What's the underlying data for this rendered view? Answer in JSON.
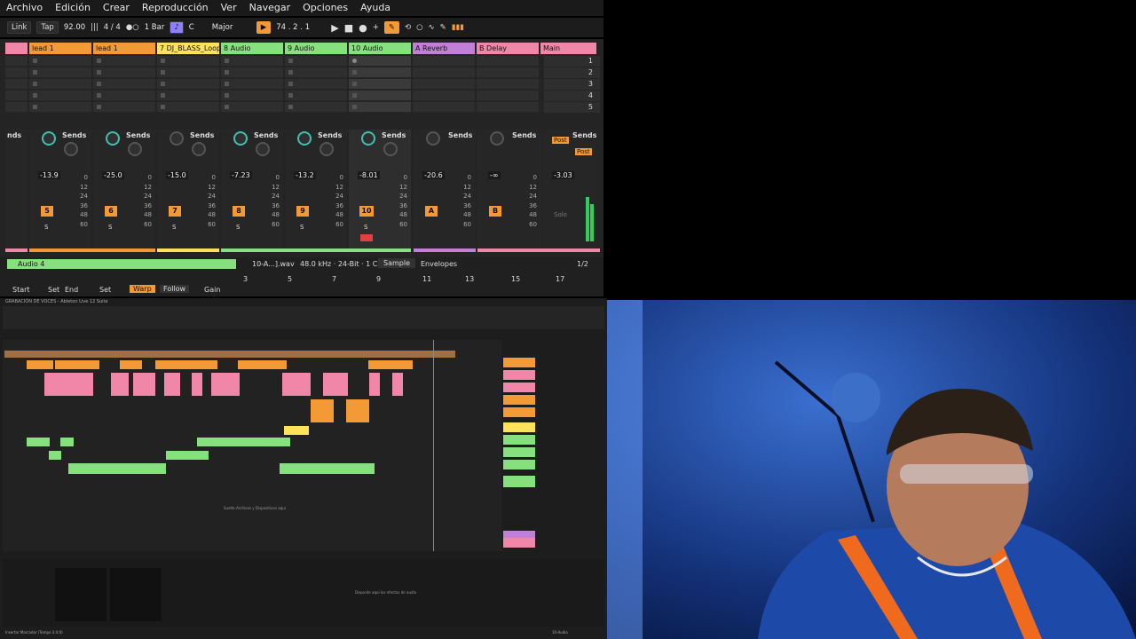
{
  "menu": [
    "Archivo",
    "Edición",
    "Crear",
    "Reproducción",
    "Ver",
    "Navegar",
    "Opciones",
    "Ayuda"
  ],
  "transport": {
    "link": "Link",
    "tap": "Tap",
    "tempo": "92.00",
    "signature": "4 / 4",
    "quantize": "1 Bar",
    "key": "C",
    "scale": "Major",
    "position": "74 .  2 .  1"
  },
  "tracks": [
    {
      "name": "",
      "color": "#f087a8"
    },
    {
      "name": "lead 1",
      "color": "#f39a36"
    },
    {
      "name": "lead 1",
      "color": "#f39a36"
    },
    {
      "name": "7 DJ_BLASS_Loop",
      "color": "#ffe15a"
    },
    {
      "name": "8 Audio",
      "color": "#87e07e"
    },
    {
      "name": "9 Audio",
      "color": "#87e07e"
    },
    {
      "name": "10 Audio",
      "color": "#87e07e"
    },
    {
      "name": "A Reverb",
      "color": "#c27fd6"
    },
    {
      "name": "B Delay",
      "color": "#f087a8"
    },
    {
      "name": "Main",
      "color": "#f087a8"
    }
  ],
  "scenes": [
    "1",
    "2",
    "3",
    "4",
    "5"
  ],
  "mixer": {
    "sends_label": "Sends",
    "send_a": "A",
    "send_b": "B",
    "post": "Post",
    "volumes": [
      "-13.9",
      "-25.0",
      "-15.0",
      "-7.23",
      "-13.2",
      "-8.01",
      "-20.6",
      "-∞",
      "-3.03"
    ],
    "numbers": [
      "5",
      "6",
      "7",
      "8",
      "9",
      "10",
      "A",
      "B"
    ],
    "solo_label": "S",
    "solo_main": "Solo",
    "ticks": [
      "0",
      "12",
      "24",
      "36",
      "48",
      "60"
    ],
    "left_partial": "nds"
  },
  "clip": {
    "track_name": "Audio 4",
    "file": "10-A...].wav",
    "rate": "48.0 kHz · 24-Bit · 1 Ch",
    "sample_tab": "Sample",
    "envelopes_tab": "Envelopes",
    "page": "1/2",
    "start": "Start",
    "end": "End",
    "set1": "Set",
    "set2": "Set",
    "warp": "Warp",
    "follow": "Follow",
    "gain": "Gain",
    "ruler": [
      "3",
      "5",
      "7",
      "9",
      "11",
      "13",
      "15",
      "17"
    ]
  },
  "nested": {
    "title": "GRABACIÓN DE VOCES - Ableton Live 12 Suite",
    "drop_hint": "Suelte Archivos y Dispositivos aquí",
    "device_hint": "Deposite aquí los efectos de audio",
    "status": "Insertar Marcador (Tempo 3:4:0)",
    "track_ref": "10-Audio"
  }
}
